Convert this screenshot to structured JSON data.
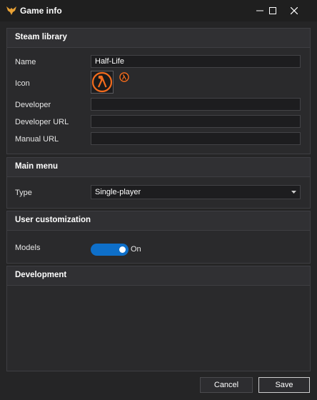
{
  "window": {
    "title": "Game info"
  },
  "sections": {
    "steam_library": {
      "title": "Steam library",
      "fields": {
        "name_label": "Name",
        "name_value": "Half-Life",
        "icon_label": "Icon",
        "developer_label": "Developer",
        "developer_value": "",
        "developer_url_label": "Developer URL",
        "developer_url_value": "",
        "manual_url_label": "Manual URL",
        "manual_url_value": ""
      }
    },
    "main_menu": {
      "title": "Main menu",
      "type_label": "Type",
      "type_value": "Single-player"
    },
    "user_customization": {
      "title": "User customization",
      "models_label": "Models",
      "models_state": "On"
    },
    "development": {
      "title": "Development"
    }
  },
  "buttons": {
    "cancel": "Cancel",
    "save": "Save"
  },
  "colors": {
    "accent": "#0e6fc9",
    "halflife_orange": "#f26b1d"
  }
}
